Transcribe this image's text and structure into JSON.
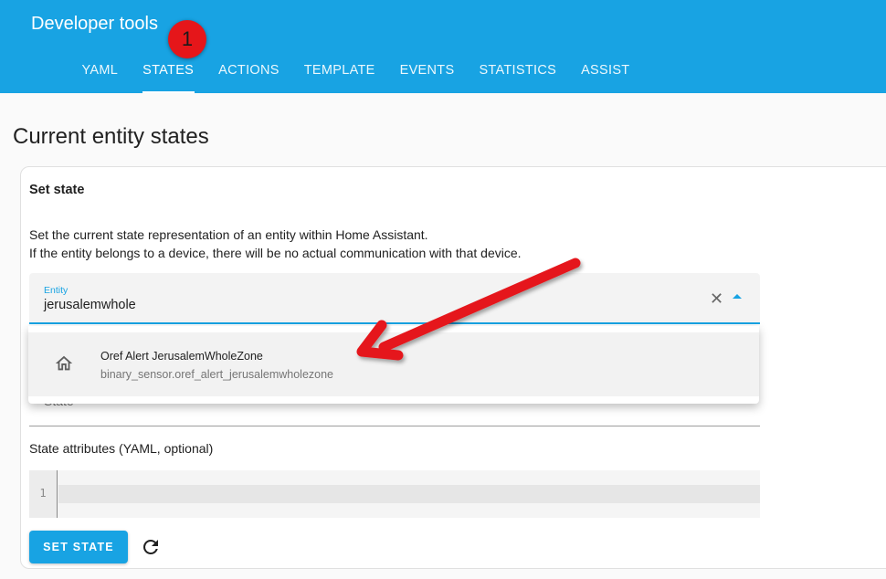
{
  "header": {
    "title": "Developer tools",
    "tabs": [
      {
        "label": "YAML"
      },
      {
        "label": "STATES"
      },
      {
        "label": "ACTIONS"
      },
      {
        "label": "TEMPLATE"
      },
      {
        "label": "EVENTS"
      },
      {
        "label": "STATISTICS"
      },
      {
        "label": "ASSIST"
      }
    ],
    "active_tab": "STATES"
  },
  "annotation": {
    "badge_number": "1"
  },
  "page": {
    "title": "Current entity states"
  },
  "card": {
    "title": "Set state",
    "description_line1": "Set the current state representation of an entity within Home Assistant.",
    "description_line2": "If the entity belongs to a device, there will be no actual communication with that device.",
    "entity_label": "Entity",
    "entity_value": "jerusalemwhole",
    "state_label": "State",
    "attributes_label": "State attributes (YAML, optional)",
    "editor_line_number": "1",
    "set_state_button": "SET STATE"
  },
  "dropdown": {
    "items": [
      {
        "icon": "home-icon",
        "primary": "Oref Alert JerusalemWholeZone",
        "secondary": "binary_sensor.oref_alert_jerusalemwholezone"
      }
    ]
  },
  "colors": {
    "primary": "#18a3e3",
    "annotation_red": "#e5161a"
  }
}
